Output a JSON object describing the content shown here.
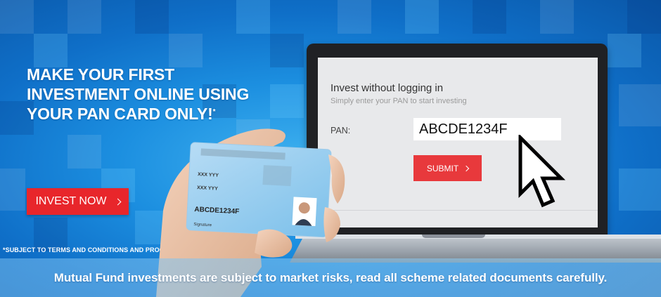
{
  "banner": {
    "headline_line1": "MAKE YOUR FIRST",
    "headline_line2": "INVESTMENT ONLINE USING",
    "headline_line3": "YOUR PAN CARD ONLY!",
    "headline_mark": "*",
    "invest_now_label": "INVEST NOW",
    "terms_note": "*SUBJECT TO TERMS AND CONDITIONS AND PROCESS.",
    "risk_disclaimer": "Mutual Fund investments are subject to market risks, read all scheme related documents carefully."
  },
  "laptop_form": {
    "title": "Invest without logging in",
    "subtitle": "Simply enter your PAN to start investing",
    "pan_label": "PAN:",
    "pan_value": "ABCDE1234F",
    "submit_label": "SUBMIT"
  },
  "pan_card": {
    "line1": "XXX YYY",
    "line2": "XXX YYY",
    "pan_number": "ABCDE1234F",
    "signature_label": "Signature"
  },
  "colors": {
    "accent_red": "#e8262b",
    "background_blue": "#1c8fe0"
  },
  "icons": [
    "chevron-right-icon",
    "mouse-pointer-icon"
  ]
}
